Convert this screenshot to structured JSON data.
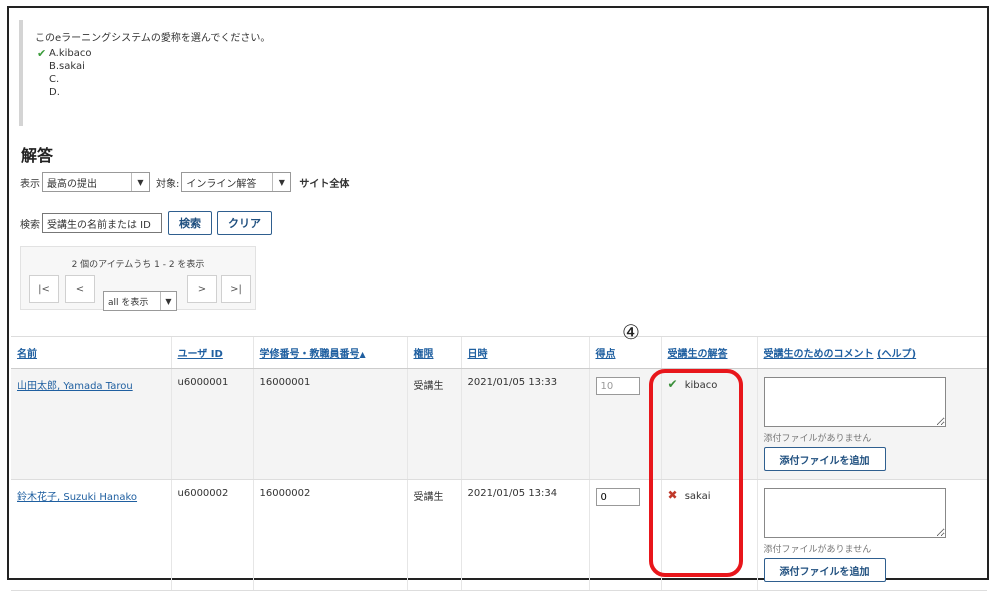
{
  "question": {
    "stem": "このeラーニングシステムの愛称を選んでください。",
    "choices": [
      {
        "label": "A.kibaco",
        "correct": true
      },
      {
        "label": "B.sakai",
        "correct": false
      },
      {
        "label": "C.",
        "correct": false
      },
      {
        "label": "D.",
        "correct": false
      }
    ]
  },
  "answers_title": "解答",
  "filters": {
    "display_label": "表示",
    "display_value": "最高の提出",
    "target_label": "対象:",
    "target_value": "インライン解答",
    "site_all": "サイト全体"
  },
  "search": {
    "label": "検索",
    "placeholder": "受講生の名前または ID",
    "search_button": "検索",
    "clear_button": "クリア"
  },
  "pager": {
    "info": "2 個のアイテムうち 1 - 2 を表示",
    "first": "|<",
    "prev": "<",
    "next": ">",
    "last": ">|",
    "show_value": "all を表示"
  },
  "marker": "④",
  "table": {
    "headers": {
      "name": "名前",
      "user_id": "ユーザ ID",
      "student_no": "学修番号・教職員番号",
      "sort_indicator": "▲",
      "role": "権限",
      "datetime": "日時",
      "score": "得点",
      "answer": "受講生の解答",
      "comment": "受講生のためのコメント",
      "help": "(ヘルプ)"
    },
    "rows": [
      {
        "name": "山田太郎, Yamada Tarou",
        "user_id": "u6000001",
        "student_no": "16000001",
        "role": "受講生",
        "datetime": "2021/01/05 13:33",
        "score": "10",
        "answer": "kibaco",
        "answer_correct": true,
        "no_attachment": "添付ファイルがありません",
        "add_attachment": "添付ファイルを追加"
      },
      {
        "name": "鈴木花子, Suzuki Hanako",
        "user_id": "u6000002",
        "student_no": "16000002",
        "role": "受講生",
        "datetime": "2021/01/05 13:34",
        "score": "0",
        "answer": "sakai",
        "answer_correct": false,
        "no_attachment": "添付ファイルがありません",
        "add_attachment": "添付ファイルを追加"
      }
    ]
  },
  "colors": {
    "link": "#1f5fa0",
    "correct": "#3a8f3a",
    "incorrect": "#c0392b",
    "highlight": "#e8161b"
  }
}
